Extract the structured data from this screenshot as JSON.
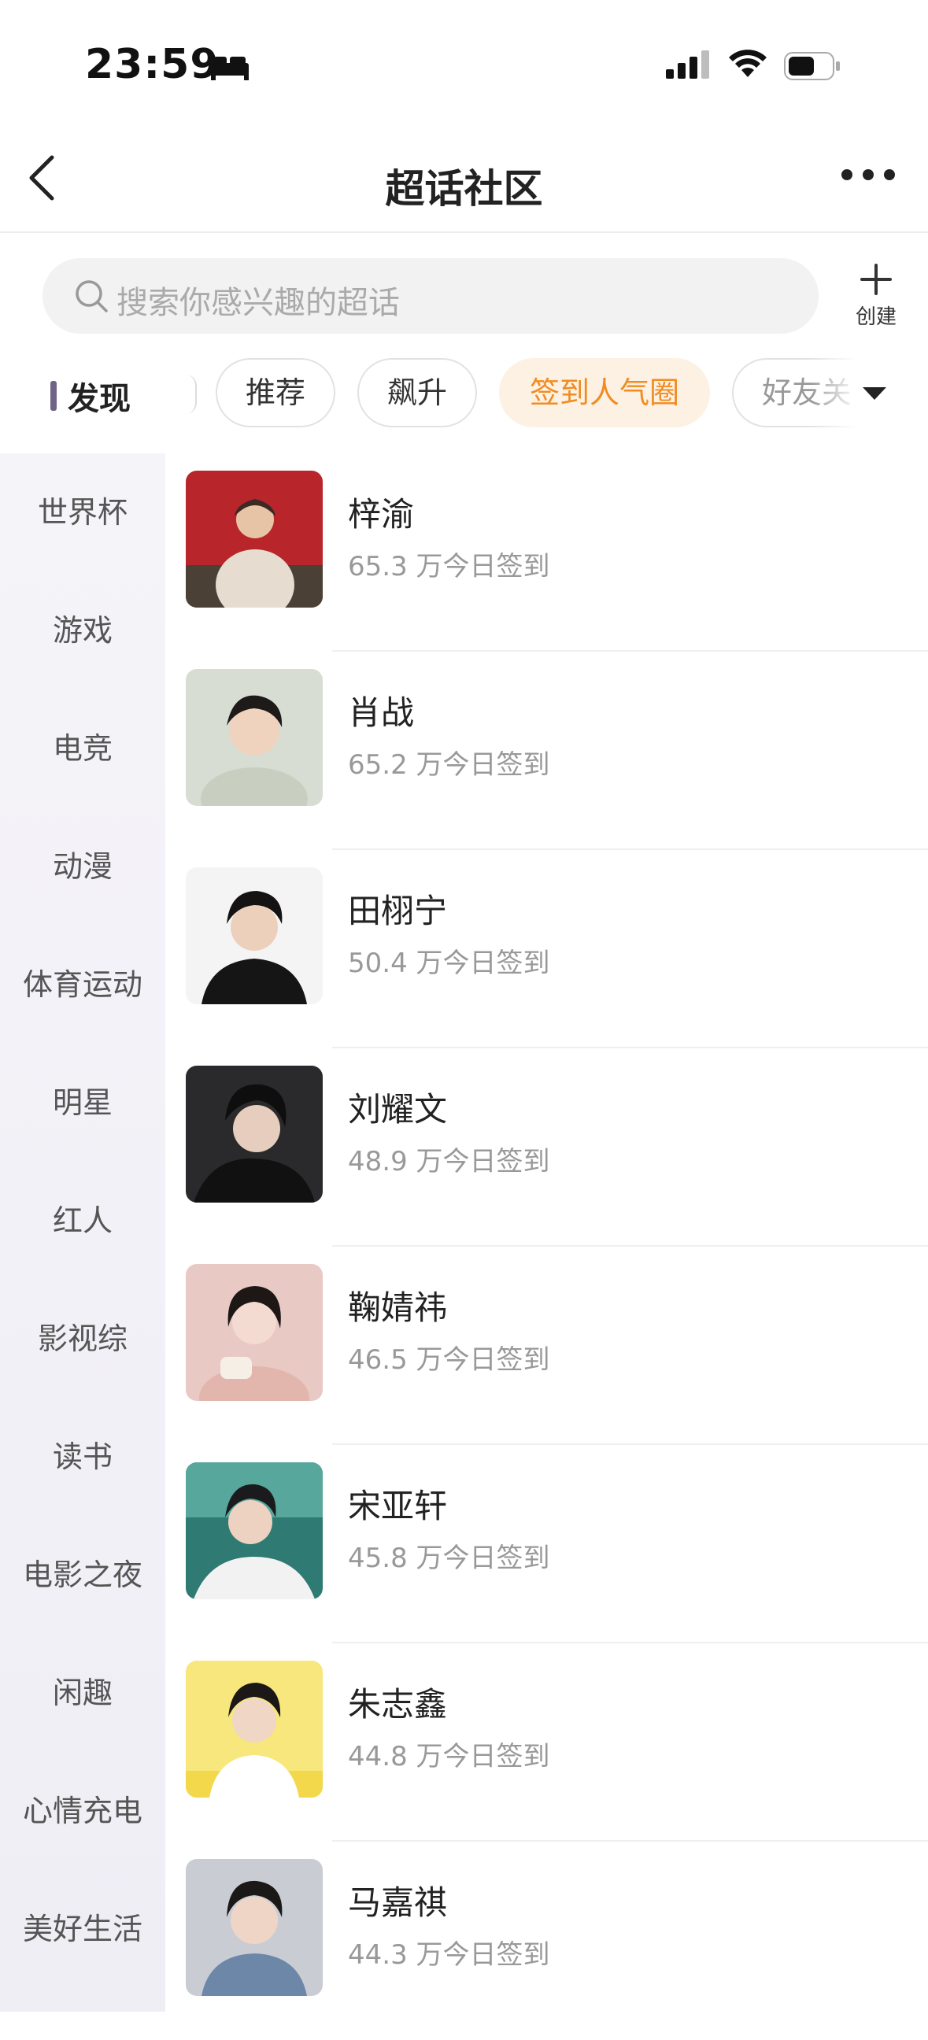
{
  "status": {
    "time": "23:59"
  },
  "nav": {
    "title": "超话社区"
  },
  "search": {
    "placeholder": "搜索你感兴趣的超话",
    "create_label": "创建"
  },
  "tabs": {
    "discover": "发现",
    "chips": [
      "推荐",
      "飙升",
      "签到人气圈",
      "好友关"
    ],
    "active_index": 2
  },
  "sidebar": {
    "items": [
      "世界杯",
      "游戏",
      "电竞",
      "动漫",
      "体育运动",
      "明星",
      "红人",
      "影视综",
      "读书",
      "电影之夜",
      "闲趣",
      "心情充电",
      "美好生活"
    ]
  },
  "communities": [
    {
      "name": "梓渝",
      "checkins": "65.3 万今日签到"
    },
    {
      "name": "肖战",
      "checkins": "65.2 万今日签到"
    },
    {
      "name": "田栩宁",
      "checkins": "50.4 万今日签到"
    },
    {
      "name": "刘耀文",
      "checkins": "48.9 万今日签到"
    },
    {
      "name": "鞠婧祎",
      "checkins": "46.5 万今日签到"
    },
    {
      "name": "宋亚轩",
      "checkins": "45.8 万今日签到"
    },
    {
      "name": "朱志鑫",
      "checkins": "44.8 万今日签到"
    },
    {
      "name": "马嘉祺",
      "checkins": "44.3 万今日签到"
    }
  ],
  "colors": {
    "accent": "#f08c22",
    "accent_bg": "#fdf1e3",
    "sidebar_bg": "#f3f2f8"
  }
}
